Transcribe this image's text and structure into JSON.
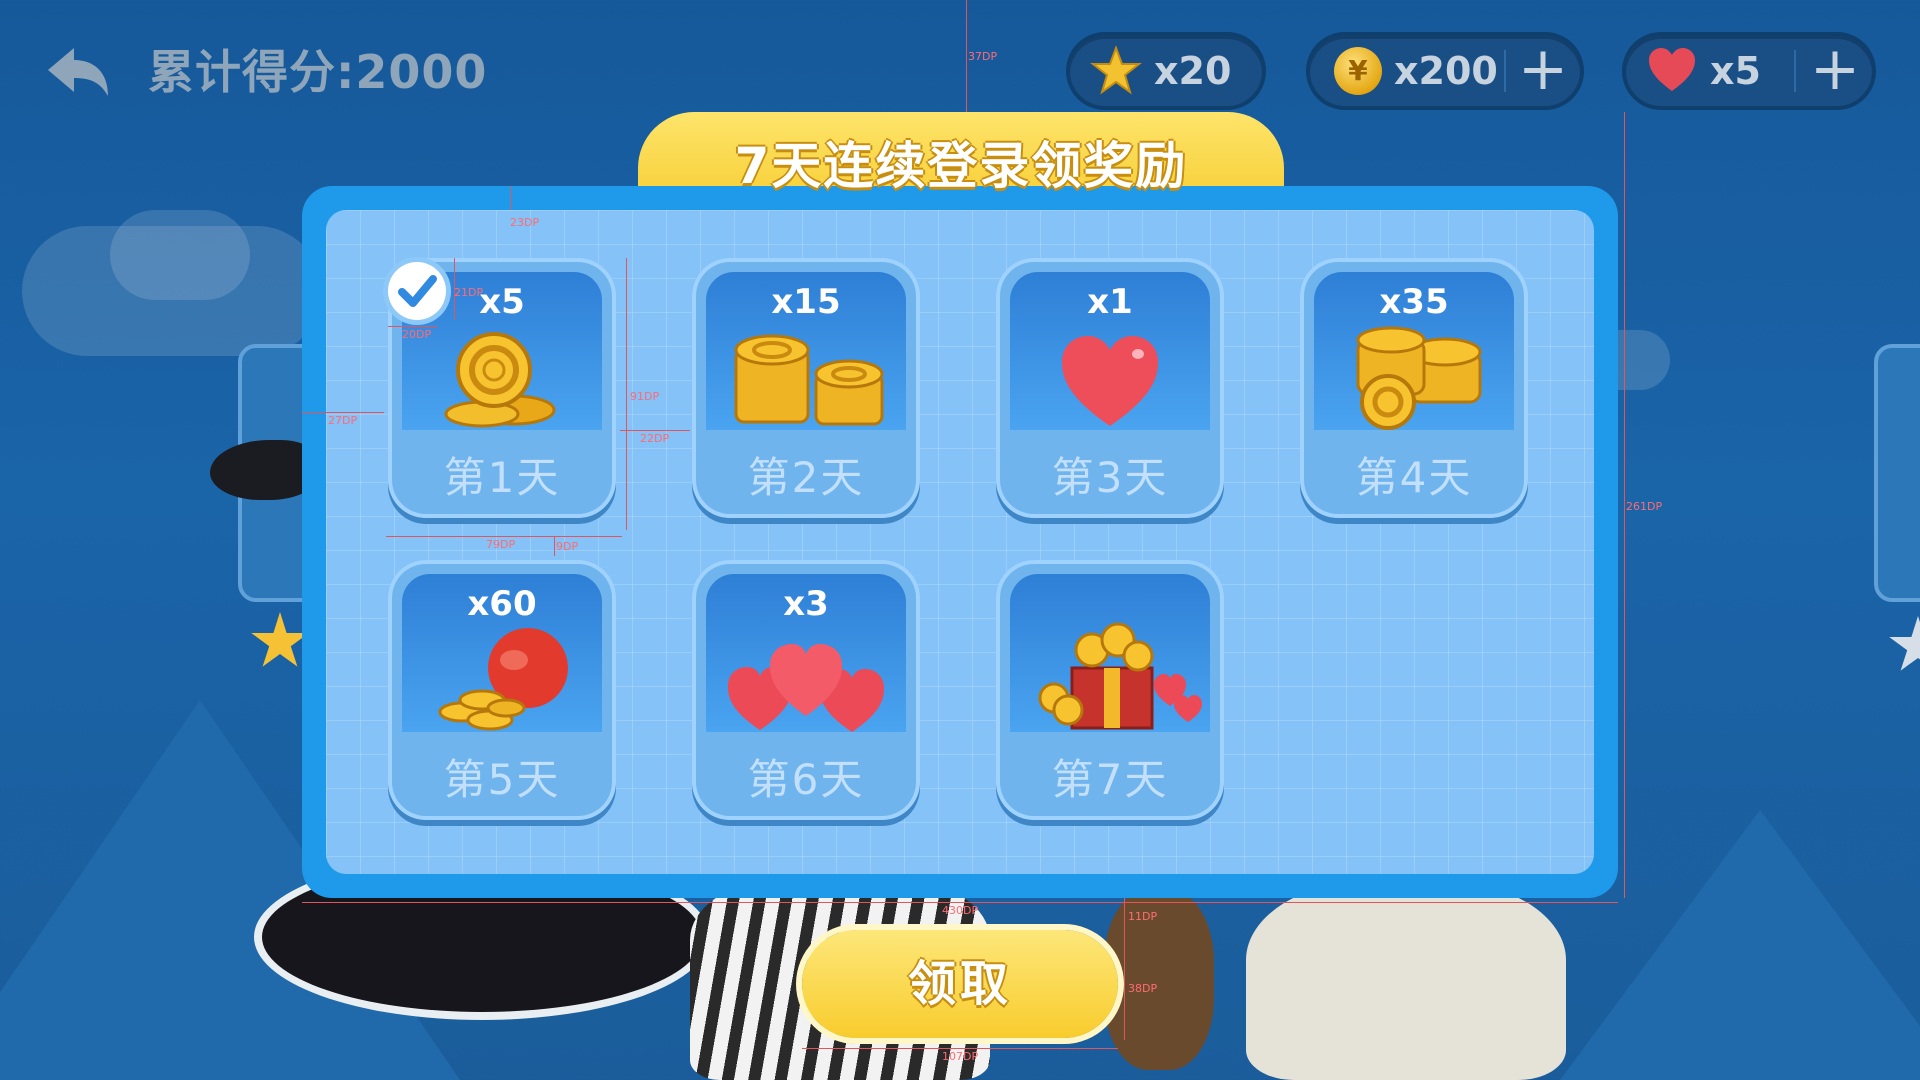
{
  "header": {
    "score_label": "累计得分:2000",
    "stars": {
      "icon": "star-icon",
      "value": "x20"
    },
    "coins": {
      "icon": "coin-icon",
      "symbol": "¥",
      "value": "x200",
      "add": "+"
    },
    "lives": {
      "icon": "heart-icon",
      "value": "x5",
      "add": "+"
    }
  },
  "dialog": {
    "title": "7天连续登录领奖励",
    "days": [
      {
        "day": "第1天",
        "amount": "x5",
        "reward": "coins",
        "claimed": true
      },
      {
        "day": "第2天",
        "amount": "x15",
        "reward": "coin-stacks",
        "claimed": false
      },
      {
        "day": "第3天",
        "amount": "x1",
        "reward": "heart",
        "claimed": false
      },
      {
        "day": "第4天",
        "amount": "x35",
        "reward": "coin-pile",
        "claimed": false
      },
      {
        "day": "第5天",
        "amount": "x60",
        "reward": "coin-bag",
        "claimed": false
      },
      {
        "day": "第6天",
        "amount": "x3",
        "reward": "hearts",
        "claimed": false
      },
      {
        "day": "第7天",
        "amount": "",
        "reward": "treasure-box",
        "claimed": false
      }
    ],
    "claim_button": "领取"
  },
  "annotations": [
    "37DP",
    "23DP",
    "21DP",
    "20DP",
    "27DP",
    "91DP",
    "22DP",
    "79DP",
    "9DP",
    "261DP",
    "430DP",
    "11DP",
    "38DP",
    "107DP"
  ],
  "colors": {
    "background": "#1a64a8",
    "panel_border": "#1f99e9",
    "title_yellow": "#f6c928",
    "annotation": "#e0565f"
  }
}
